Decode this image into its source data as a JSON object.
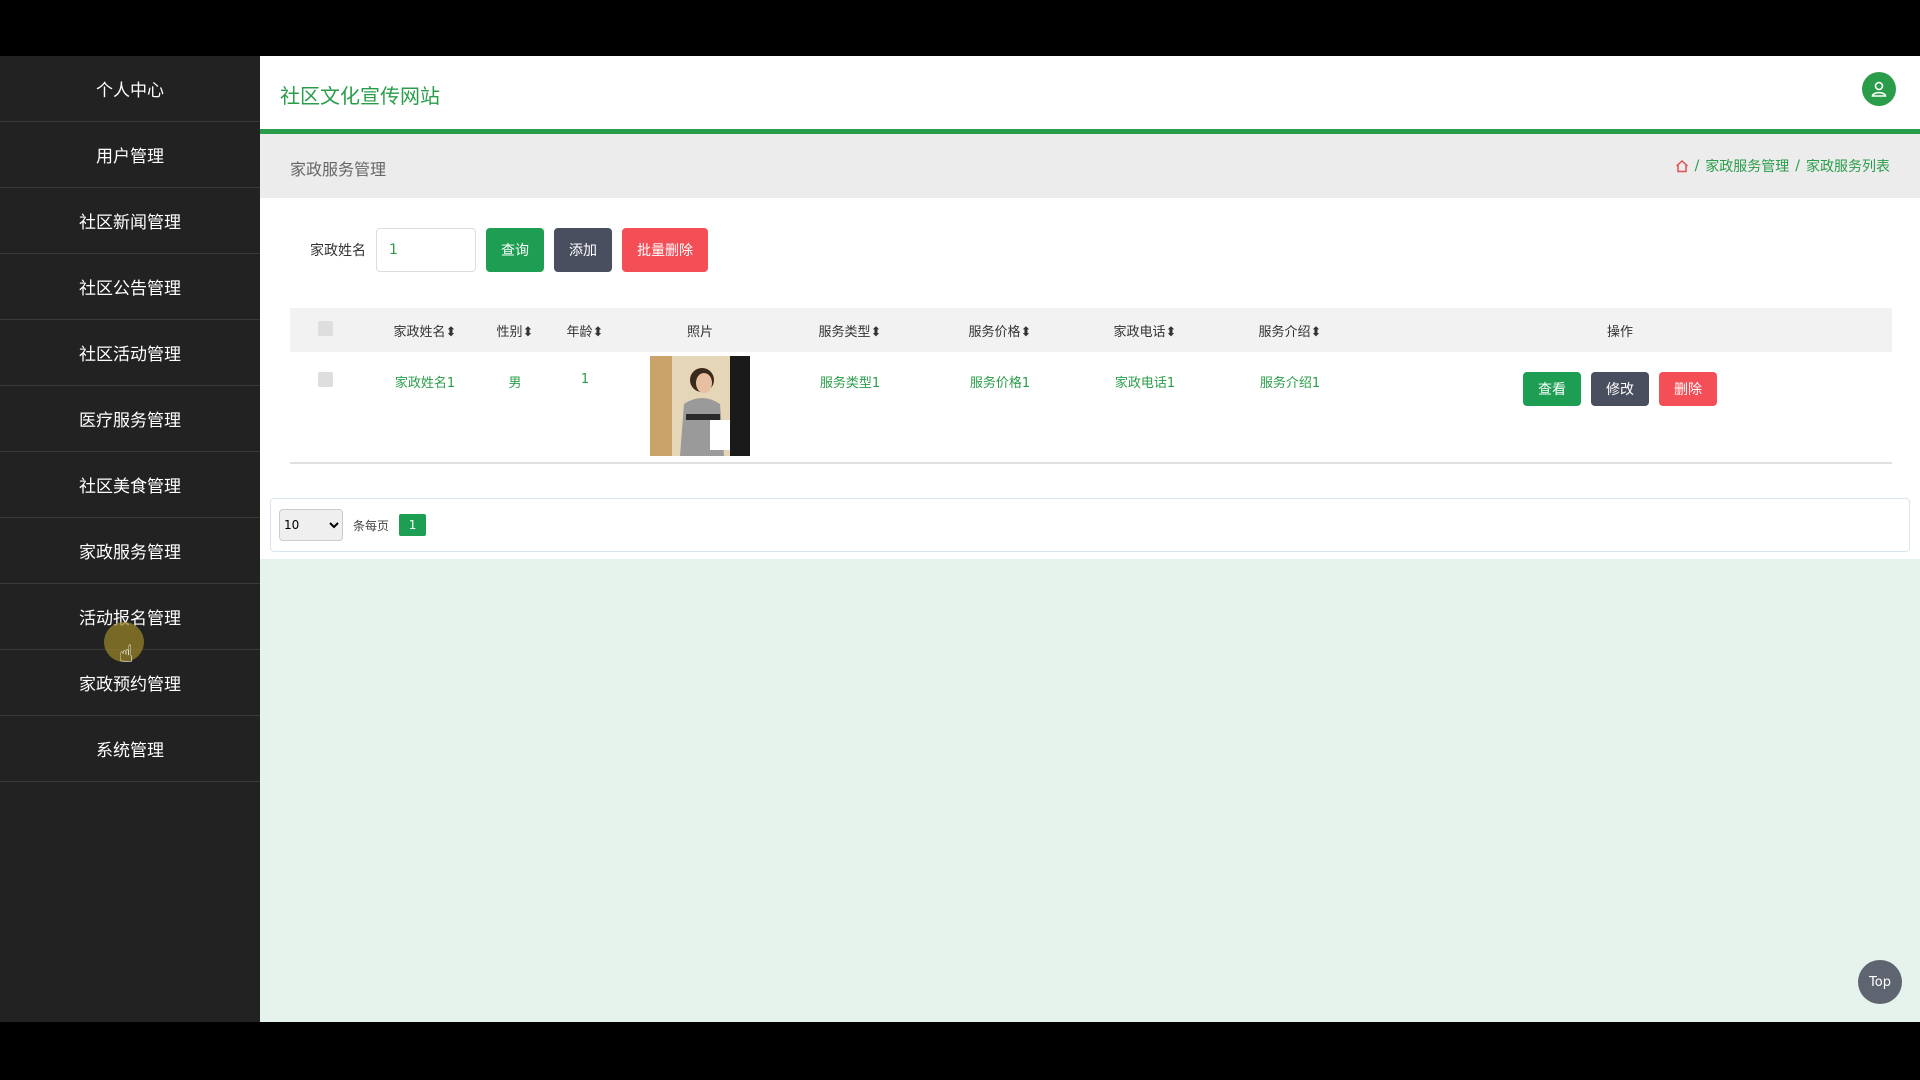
{
  "sidebar": {
    "items": [
      {
        "label": "个人中心"
      },
      {
        "label": "用户管理"
      },
      {
        "label": "社区新闻管理"
      },
      {
        "label": "社区公告管理"
      },
      {
        "label": "社区活动管理"
      },
      {
        "label": "医疗服务管理"
      },
      {
        "label": "社区美食管理"
      },
      {
        "label": "家政服务管理"
      },
      {
        "label": "活动报名管理"
      },
      {
        "label": "家政预约管理"
      },
      {
        "label": "系统管理"
      }
    ]
  },
  "header": {
    "title": "社区文化宣传网站"
  },
  "breadcrumb": {
    "page_title": "家政服务管理",
    "level1": "家政服务管理",
    "level2": "家政服务列表",
    "sep": "/"
  },
  "search": {
    "label": "家政姓名",
    "value": "1",
    "query_btn": "查询",
    "add_btn": "添加",
    "batch_delete_btn": "批量删除"
  },
  "table": {
    "headers": {
      "name": "家政姓名",
      "sex": "性别",
      "age": "年龄",
      "photo": "照片",
      "type": "服务类型",
      "price": "服务价格",
      "phone": "家政电话",
      "intro": "服务介绍",
      "op": "操作"
    },
    "sort_glyph": "⬍",
    "rows": [
      {
        "name": "家政姓名1",
        "sex": "男",
        "age": "1",
        "type": "服务类型1",
        "price": "服务价格1",
        "phone": "家政电话1",
        "intro": "服务介绍1",
        "view": "查看",
        "edit": "修改",
        "del": "删除"
      }
    ]
  },
  "pager": {
    "size": "10",
    "per_page": "条每页",
    "current": "1"
  },
  "top_btn": "Top",
  "colors": {
    "accent": "#2a9d4a",
    "danger": "#f44e56",
    "dark": "#4a4f5f"
  }
}
